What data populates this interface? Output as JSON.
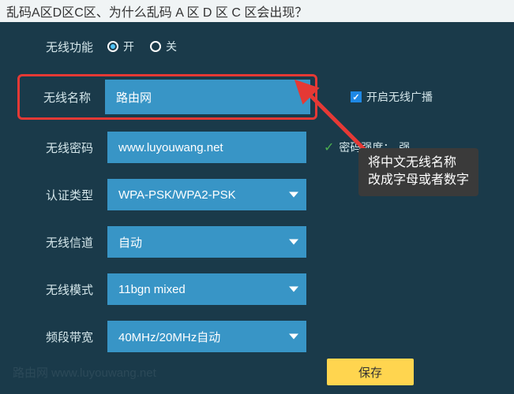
{
  "title": "乱码A区D区C区、为什么乱码 A 区 D 区 C 区会出现？",
  "form": {
    "wireless_func": {
      "label": "无线功能",
      "on": "开",
      "off": "关"
    },
    "ssid": {
      "label": "无线名称",
      "value": "路由网",
      "broadcast": "开启无线广播"
    },
    "password": {
      "label": "无线密码",
      "value": "www.luyouwang.net",
      "strength_label": "密码强度：",
      "strength_value": "强"
    },
    "auth": {
      "label": "认证类型",
      "value": "WPA-PSK/WPA2-PSK"
    },
    "channel": {
      "label": "无线信道",
      "value": "自动"
    },
    "mode": {
      "label": "无线模式",
      "value": "11bgn mixed"
    },
    "bandwidth": {
      "label": "频段带宽",
      "value": "40MHz/20MHz自动"
    }
  },
  "tooltip": {
    "line1": "将中文无线名称",
    "line2": "改成字母或者数字"
  },
  "save": "保存",
  "watermark": "路由网 www.luyouwang.net"
}
